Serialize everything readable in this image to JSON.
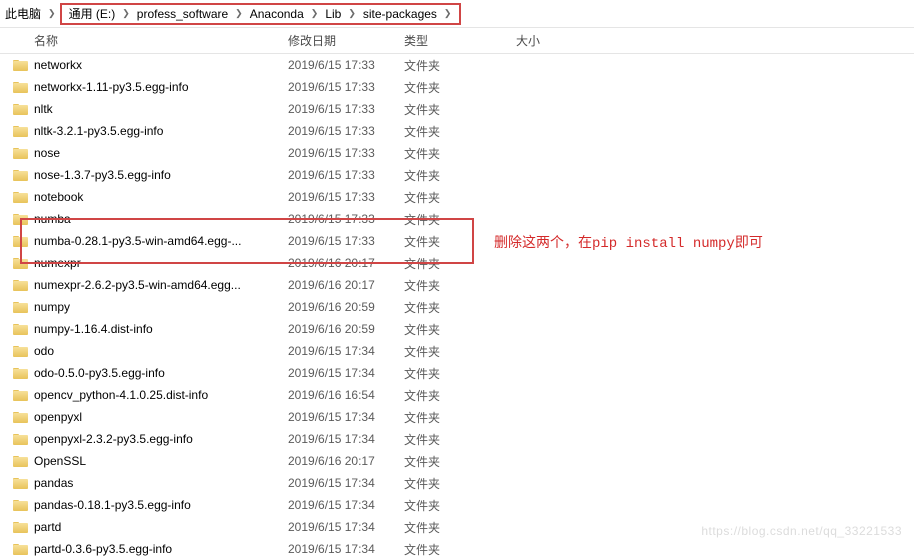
{
  "breadcrumb": {
    "root": "此电脑",
    "items": [
      "通用 (E:)",
      "profess_software",
      "Anaconda",
      "Lib",
      "site-packages"
    ]
  },
  "headers": {
    "name": "名称",
    "date": "修改日期",
    "type": "类型",
    "size": "大小"
  },
  "rows": [
    {
      "name": "networkx",
      "date": "2019/6/15 17:33",
      "type": "文件夹"
    },
    {
      "name": "networkx-1.11-py3.5.egg-info",
      "date": "2019/6/15 17:33",
      "type": "文件夹"
    },
    {
      "name": "nltk",
      "date": "2019/6/15 17:33",
      "type": "文件夹"
    },
    {
      "name": "nltk-3.2.1-py3.5.egg-info",
      "date": "2019/6/15 17:33",
      "type": "文件夹"
    },
    {
      "name": "nose",
      "date": "2019/6/15 17:33",
      "type": "文件夹"
    },
    {
      "name": "nose-1.3.7-py3.5.egg-info",
      "date": "2019/6/15 17:33",
      "type": "文件夹"
    },
    {
      "name": "notebook",
      "date": "2019/6/15 17:33",
      "type": "文件夹"
    },
    {
      "name": "numba",
      "date": "2019/6/15 17:33",
      "type": "文件夹"
    },
    {
      "name": "numba-0.28.1-py3.5-win-amd64.egg-...",
      "date": "2019/6/15 17:33",
      "type": "文件夹"
    },
    {
      "name": "numexpr",
      "date": "2019/6/16 20:17",
      "type": "文件夹"
    },
    {
      "name": "numexpr-2.6.2-py3.5-win-amd64.egg...",
      "date": "2019/6/16 20:17",
      "type": "文件夹"
    },
    {
      "name": "numpy",
      "date": "2019/6/16 20:59",
      "type": "文件夹"
    },
    {
      "name": "numpy-1.16.4.dist-info",
      "date": "2019/6/16 20:59",
      "type": "文件夹"
    },
    {
      "name": "odo",
      "date": "2019/6/15 17:34",
      "type": "文件夹"
    },
    {
      "name": "odo-0.5.0-py3.5.egg-info",
      "date": "2019/6/15 17:34",
      "type": "文件夹"
    },
    {
      "name": "opencv_python-4.1.0.25.dist-info",
      "date": "2019/6/16 16:54",
      "type": "文件夹"
    },
    {
      "name": "openpyxl",
      "date": "2019/6/15 17:34",
      "type": "文件夹"
    },
    {
      "name": "openpyxl-2.3.2-py3.5.egg-info",
      "date": "2019/6/15 17:34",
      "type": "文件夹"
    },
    {
      "name": "OpenSSL",
      "date": "2019/6/16 20:17",
      "type": "文件夹"
    },
    {
      "name": "pandas",
      "date": "2019/6/15 17:34",
      "type": "文件夹"
    },
    {
      "name": "pandas-0.18.1-py3.5.egg-info",
      "date": "2019/6/15 17:34",
      "type": "文件夹"
    },
    {
      "name": "partd",
      "date": "2019/6/15 17:34",
      "type": "文件夹"
    },
    {
      "name": "partd-0.3.6-py3.5.egg-info",
      "date": "2019/6/15 17:34",
      "type": "文件夹"
    }
  ],
  "annotation": {
    "prefix": "删除这两个，在",
    "cmd": "pip install numpy",
    "suffix": "即可"
  },
  "watermark": "https://blog.csdn.net/qq_33221533"
}
